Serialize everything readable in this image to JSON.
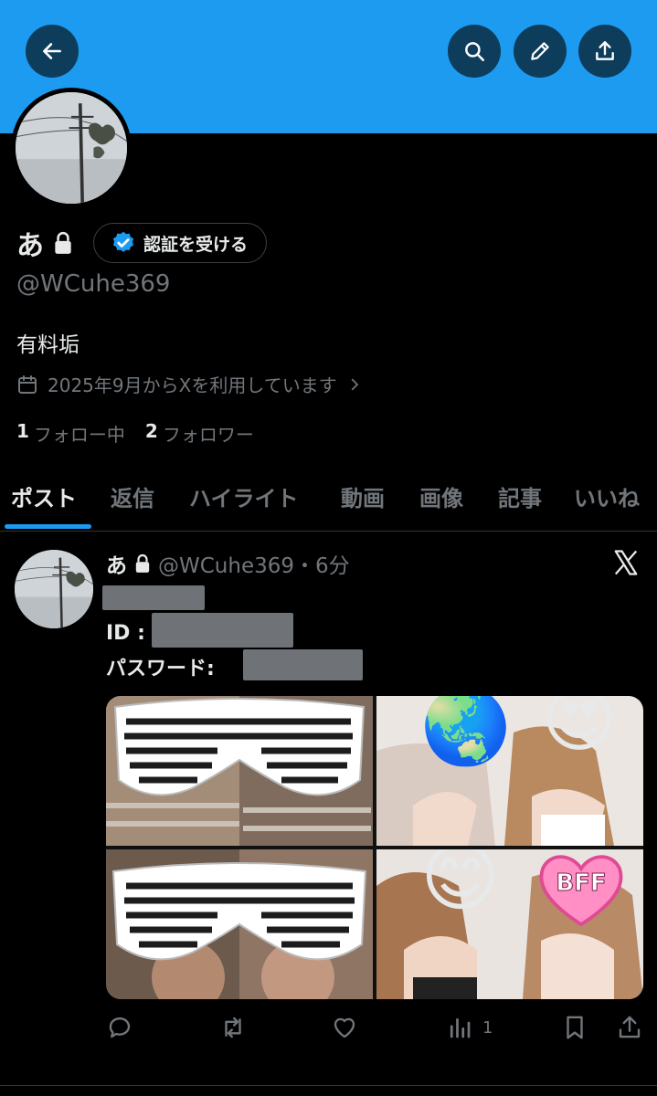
{
  "profile": {
    "display_name": "あ",
    "verify_label": "認証を受ける",
    "handle": "@WCuhe369",
    "bio": "有料垢",
    "joined": "2025年9月からXを利用しています",
    "following_count": "1",
    "following_label": "フォロー中",
    "followers_count": "2",
    "followers_label": "フォロワー"
  },
  "tabs": [
    {
      "label": "ポスト",
      "active": true
    },
    {
      "label": "返信"
    },
    {
      "label": "ハイライト"
    },
    {
      "label": "動画"
    },
    {
      "label": "画像"
    },
    {
      "label": "記事"
    },
    {
      "label": "いいね"
    }
  ],
  "post": {
    "author": "あ",
    "meta": "@WCuhe369・6分",
    "id_label": "ID :",
    "password_label": "パスワード:",
    "emojis": [
      "🌏",
      "😍",
      "😊",
      "BFF"
    ],
    "actions": {
      "views_count": "1"
    }
  },
  "colors": {
    "accent": "#1d9bf0",
    "banner": "#1d9bf0",
    "muted": "#71767b"
  },
  "icons": [
    "back-arrow-icon",
    "search-icon",
    "pencil-icon",
    "share-icon",
    "lock-icon",
    "verified-badge-icon",
    "calendar-icon",
    "chevron-right-icon",
    "x-logo-icon",
    "reply-icon",
    "repost-icon",
    "like-icon",
    "views-icon",
    "bookmark-icon"
  ]
}
